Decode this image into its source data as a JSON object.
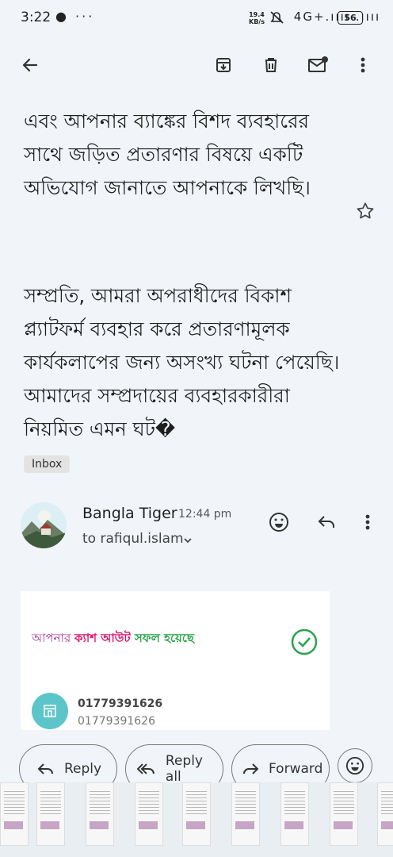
{
  "status_bar": {
    "time": "3:22",
    "left_icons": "● ···",
    "net_speed_value": "19.4",
    "net_speed_unit": "KB/s",
    "right_icons": "4G+.ıııı .ıııı",
    "battery": "56"
  },
  "toolbar": {
    "icons": [
      "back-arrow-icon",
      "archive-icon",
      "delete-icon",
      "mark-unread-icon",
      "more-vert-icon"
    ]
  },
  "email": {
    "body_para1": "আমাদের সতর্কতা উদ্বেগ প্রকাশ করতে এবং আপনার ব্যাঙ্কের বিশদ ব্যবহারের সাথে জড়িত প্রতারণার বিষয়ে একটি অভিযোগ জানাতে আপনাকে লিখছি।",
    "body_para2": "সম্প্রতি, আমরা অপরাধীদের বিকাশ প্ল্যাটফর্ম ব্যবহার করে প্রতারণামূলক কার্যকলাপের জন্য অসংখ্য ঘটনা পেয়েছি। আমাদের সম্প্রদায়ের ব্যবহারকারীরা নিয়মিত এমন ঘট�",
    "label": "Inbox",
    "sender": "Bangla Tiger",
    "time": "12:44 pm",
    "recipient": "to rafiqul.islam"
  },
  "embed": {
    "title_part1": "আপনার ",
    "title_part2": "ক্যাশ আউট ",
    "title_part3": " সফল হয়েছে",
    "phone1": "01779391626",
    "phone2": "01779391626",
    "colors": {
      "purple": "#a4329b",
      "pink": "#e0136c",
      "green": "#2aa44a",
      "teal": "#5bc5c9"
    }
  },
  "actions": {
    "reply": "Reply",
    "reply_all": "Reply all",
    "forward": "Forward"
  }
}
